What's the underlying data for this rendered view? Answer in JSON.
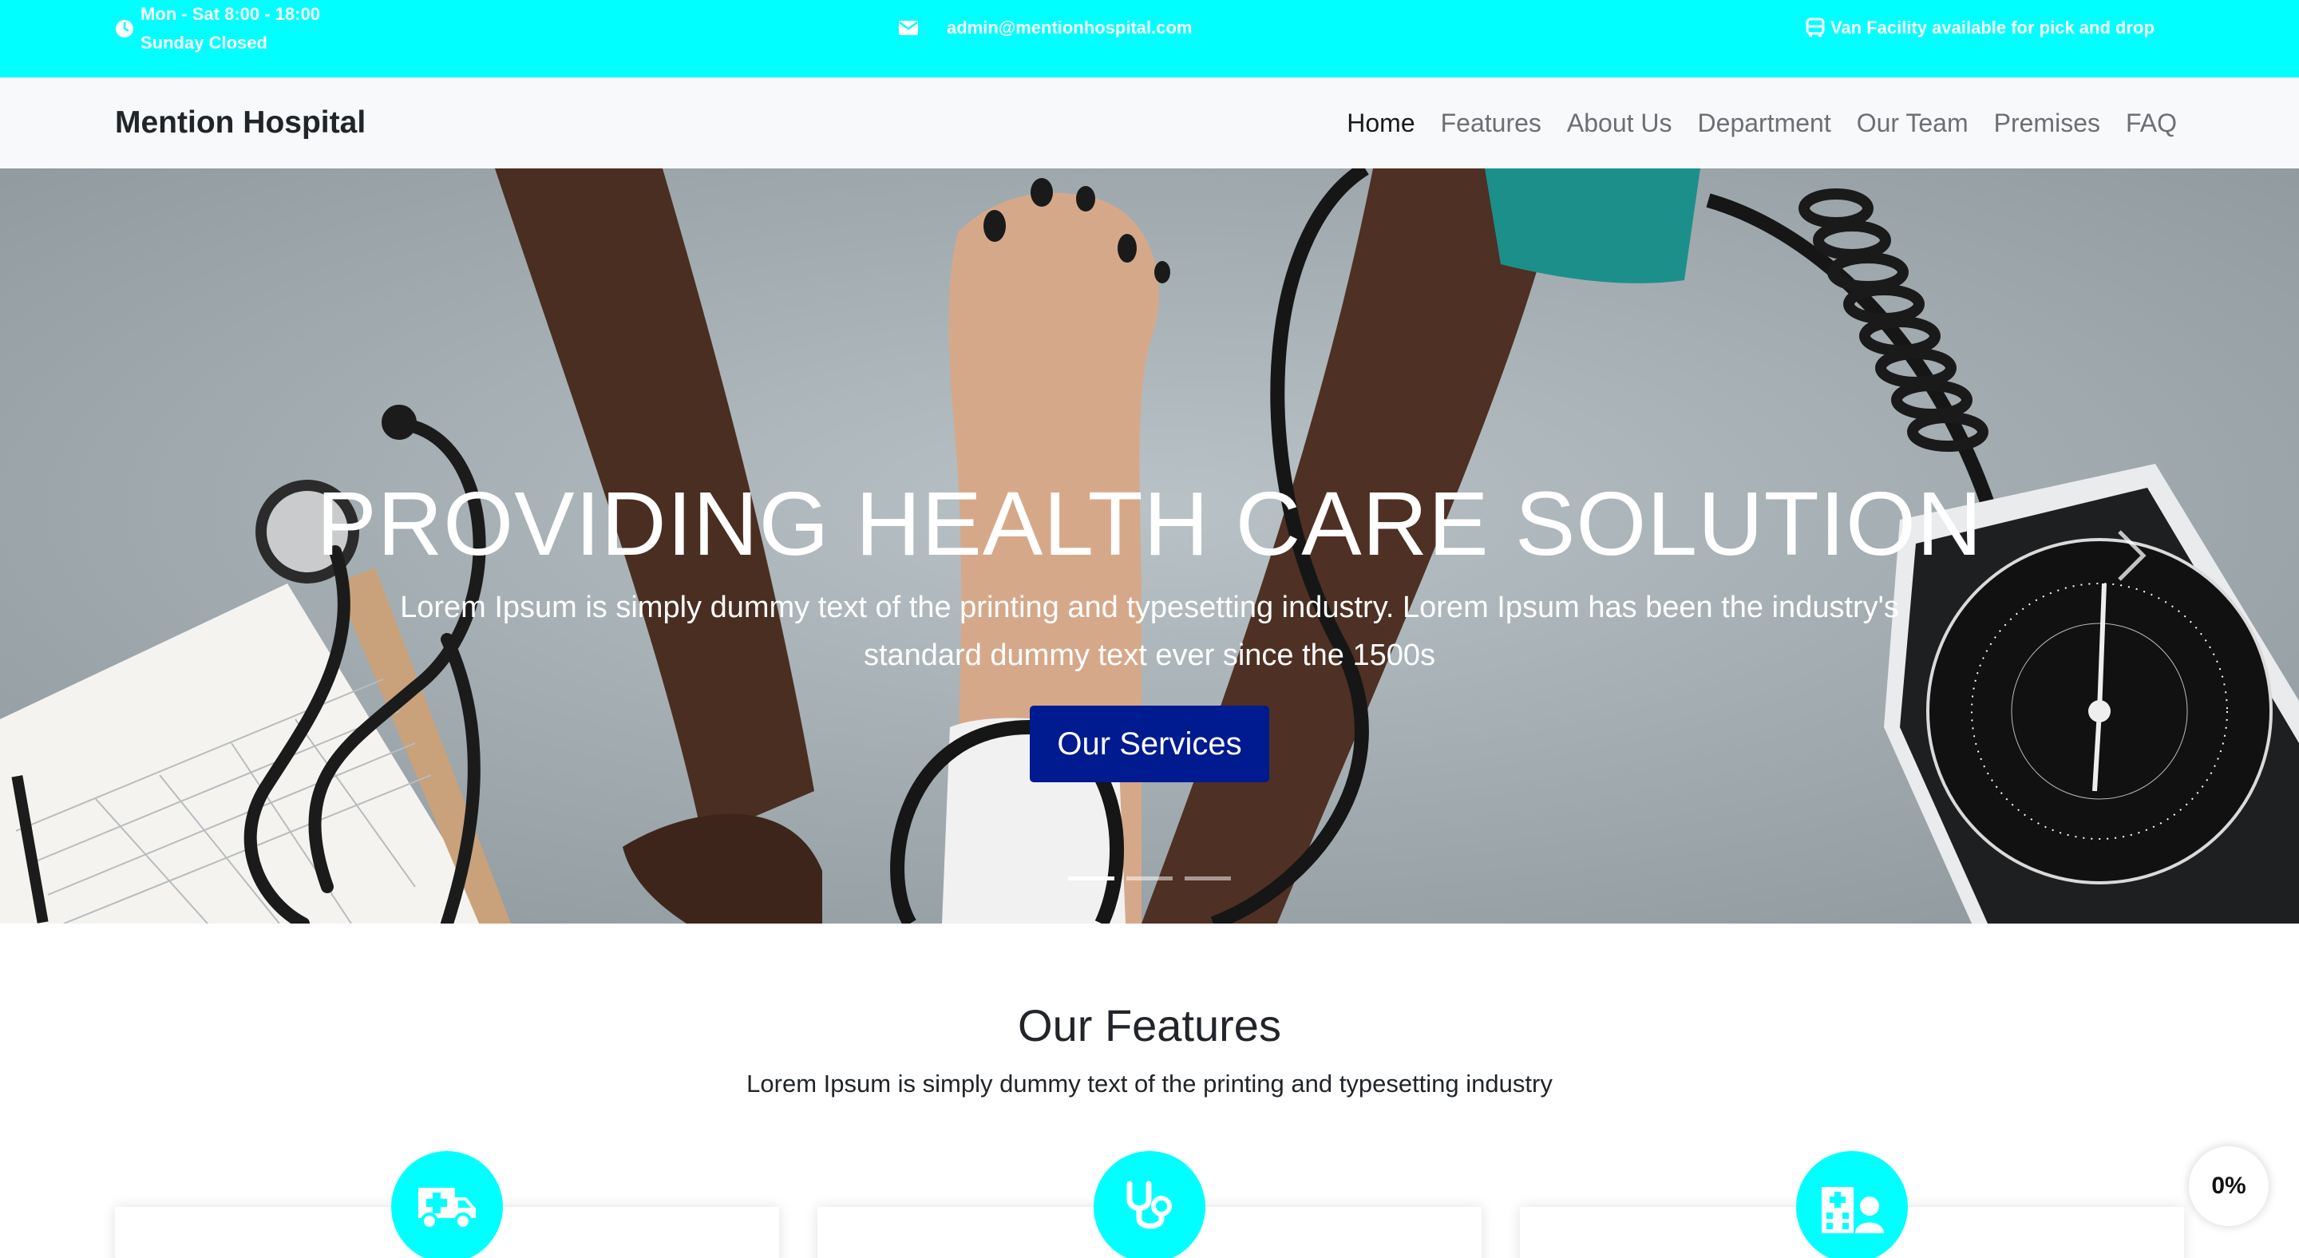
{
  "topbar": {
    "hours_line1": "Mon - Sat 8:00 - 18:00",
    "hours_line2": "Sunday Closed",
    "email": "admin@mentionhospital.com",
    "van": "Van Facility available for pick and drop",
    "icons": [
      "clock-icon",
      "envelope-icon",
      "bus-icon"
    ]
  },
  "navbar": {
    "brand": "Mention Hospital",
    "links": [
      "Home",
      "Features",
      "About Us",
      "Department",
      "Our Team",
      "Premises",
      "FAQ"
    ],
    "active": "Home"
  },
  "hero": {
    "title": "PROVIDING HEALTH CARE SOLUTION",
    "text": "Lorem Ipsum is simply dummy text of the printing and typesetting industry. Lorem Ipsum has been the industry's standard dummy text ever since the 1500s",
    "button": "Our Services",
    "slides": 3,
    "active_slide": 1
  },
  "features": {
    "title": "Our Features",
    "subtitle": "Lorem Ipsum is simply dummy text of the printing and typesetting industry",
    "icons": [
      "ambulance-icon",
      "stethoscope-icon",
      "hospital-user-icon"
    ]
  },
  "progress": {
    "label": "0%"
  },
  "colors": {
    "accent": "#00ffff",
    "button": "#001a8f",
    "navbar_bg": "#f8f9fa"
  }
}
